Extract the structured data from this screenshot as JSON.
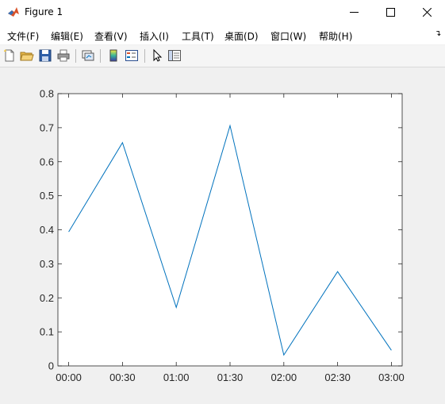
{
  "window": {
    "title": "Figure 1",
    "icon": "matlab-logo-icon",
    "controls": [
      "minimize-icon",
      "maximize-icon",
      "close-icon"
    ]
  },
  "menu": {
    "items": [
      "文件(F)",
      "编辑(E)",
      "查看(V)",
      "插入(I)",
      "工具(T)",
      "桌面(D)",
      "窗口(W)",
      "帮助(H)"
    ],
    "overflow_icon": "menu-arrow-icon"
  },
  "toolbar": {
    "buttons": [
      "new-figure-icon",
      "open-file-icon",
      "save-icon",
      "print-icon",
      "link-plot-icon",
      "insert-colorbar-icon",
      "insert-legend-icon",
      "edit-plot-icon",
      "open-property-inspector-icon"
    ]
  },
  "colors": {
    "line": "#0072bd",
    "figure_bg": "#f0f0f0",
    "axes_bg": "#ffffff",
    "axis": "#262626"
  },
  "chart_data": {
    "type": "line",
    "x": [
      "00:00",
      "00:30",
      "01:00",
      "01:30",
      "02:00",
      "02:30",
      "03:00"
    ],
    "series": [
      {
        "values": [
          0.394,
          0.656,
          0.172,
          0.706,
          0.032,
          0.277,
          0.046
        ]
      }
    ],
    "x_ticks": [
      "00:00",
      "00:30",
      "01:00",
      "01:30",
      "02:00",
      "02:30",
      "03:00"
    ],
    "y_ticks": [
      "0",
      "0.1",
      "0.2",
      "0.3",
      "0.4",
      "0.5",
      "0.6",
      "0.7",
      "0.8"
    ],
    "ylim": [
      0,
      0.8
    ],
    "xlim": [
      "23:54",
      "03:06"
    ],
    "title": "",
    "xlabel": "",
    "ylabel": "",
    "grid": false,
    "box": true
  }
}
